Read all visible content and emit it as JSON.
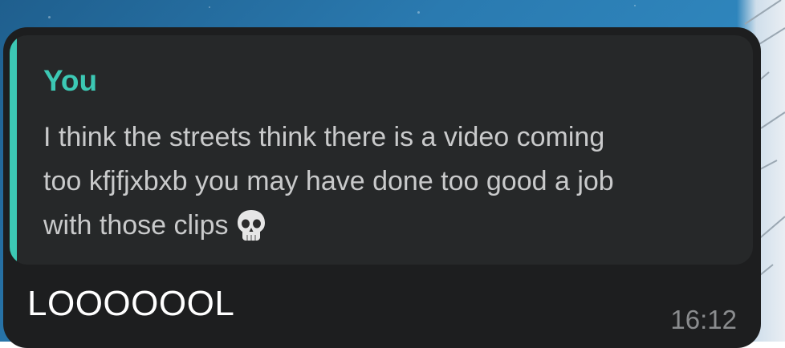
{
  "message": {
    "reply": {
      "author": "You",
      "text_line1": "I think the streets think there is a video coming",
      "text_line2": "too kfjfjxbxb you may have done too good a job",
      "text_line3": "with those clips",
      "emoji": "skull-icon"
    },
    "text": "LOOOOOOL",
    "time": "16:12"
  },
  "colors": {
    "accent": "#3cc8b4",
    "bubble": "#1d1e1f",
    "reply_bg": "#262829",
    "wallpaper": "#2a7ab0"
  }
}
